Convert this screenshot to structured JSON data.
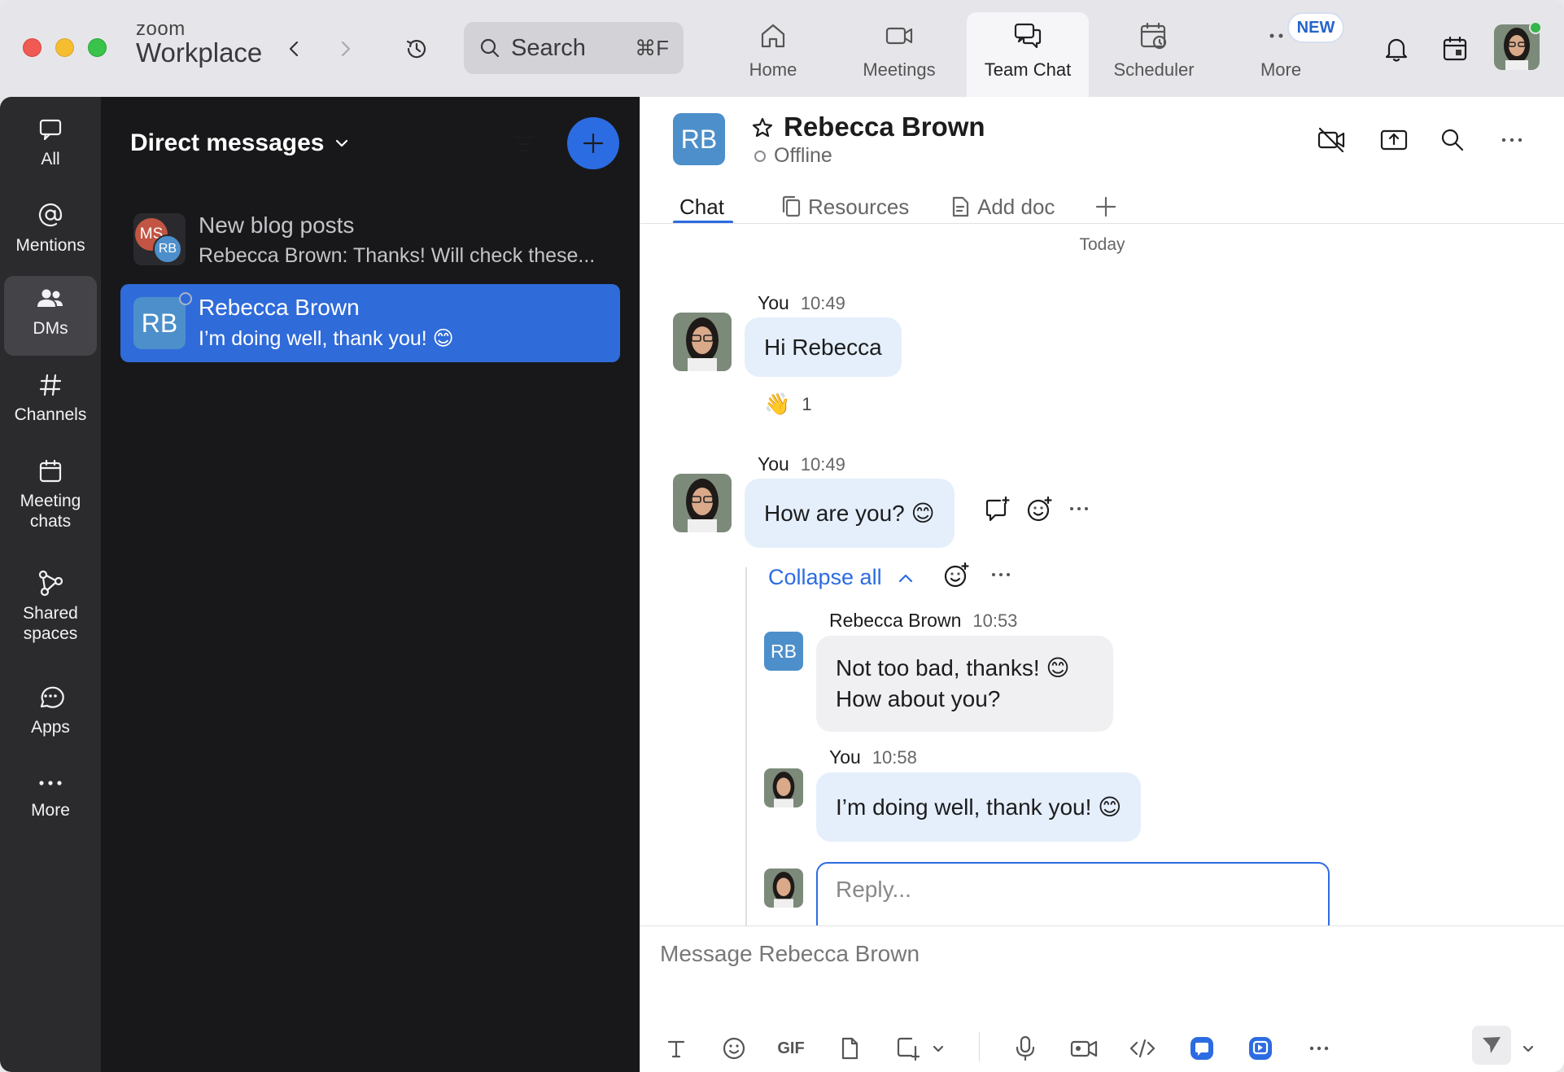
{
  "window": {
    "brand_top": "zoom",
    "brand_bottom": "Workplace"
  },
  "search": {
    "label": "Search",
    "shortcut": "⌘F"
  },
  "top_tabs": [
    {
      "label": "Home",
      "icon": "home-icon"
    },
    {
      "label": "Meetings",
      "icon": "video-camera-icon"
    },
    {
      "label": "Team Chat",
      "icon": "chat-bubbles-icon",
      "active": true
    },
    {
      "label": "Scheduler",
      "icon": "calendar-clock-icon"
    },
    {
      "label": "More",
      "icon": "more-dots-icon",
      "badge": "NEW"
    }
  ],
  "rail": [
    {
      "label": "All",
      "icon": "chat-icon"
    },
    {
      "label": "Mentions",
      "icon": "at-icon"
    },
    {
      "label": "DMs",
      "icon": "people-icon",
      "active": true
    },
    {
      "label": "Channels",
      "icon": "hash-icon"
    },
    {
      "label": "Meeting chats",
      "icon": "calendar-icon"
    },
    {
      "label": "Shared spaces",
      "icon": "nodes-icon"
    },
    {
      "label": "Apps",
      "icon": "apps-icon"
    },
    {
      "label": "More",
      "icon": "more-icon"
    }
  ],
  "list": {
    "title": "Direct messages",
    "conversations": [
      {
        "avatar_a": "MS",
        "avatar_b": "RB",
        "name": "New blog posts",
        "preview": "Rebecca Brown: Thanks!  Will check these..."
      },
      {
        "avatar": "RB",
        "name": "Rebecca Brown",
        "preview": "I’m doing well, thank you! 😊",
        "selected": true
      }
    ]
  },
  "chat": {
    "contact_initials": "RB",
    "contact_name": "Rebecca Brown",
    "contact_status": "Offline",
    "tabs": [
      "Chat",
      "Resources",
      "Add doc"
    ],
    "day_label": "Today",
    "messages": [
      {
        "sender": "You",
        "time": "10:49",
        "text": "Hi Rebecca",
        "reaction_emoji": "👋",
        "reaction_count": "1"
      },
      {
        "sender": "You",
        "time": "10:49",
        "text": "How are you? 😊"
      }
    ],
    "thread": {
      "collapse_label": "Collapse all",
      "replies": [
        {
          "sender": "Rebecca Brown",
          "initials": "RB",
          "time": "10:53",
          "line1": "Not too bad, thanks! 😊",
          "line2": "How about you?"
        },
        {
          "sender": "You",
          "time": "10:58",
          "text": "I’m doing well, thank you! 😊"
        }
      ],
      "reply_placeholder": "Reply..."
    },
    "composer_placeholder": "Message Rebecca Brown",
    "composer_tools": [
      "T",
      "emoji",
      "GIF",
      "file",
      "screenshot",
      "mic",
      "video",
      "code",
      "app1",
      "app2",
      "more"
    ]
  },
  "colors": {
    "accent": "#2c6ce2",
    "selected_row": "#2f6bd9",
    "rb_avatar": "#4d8fca"
  }
}
